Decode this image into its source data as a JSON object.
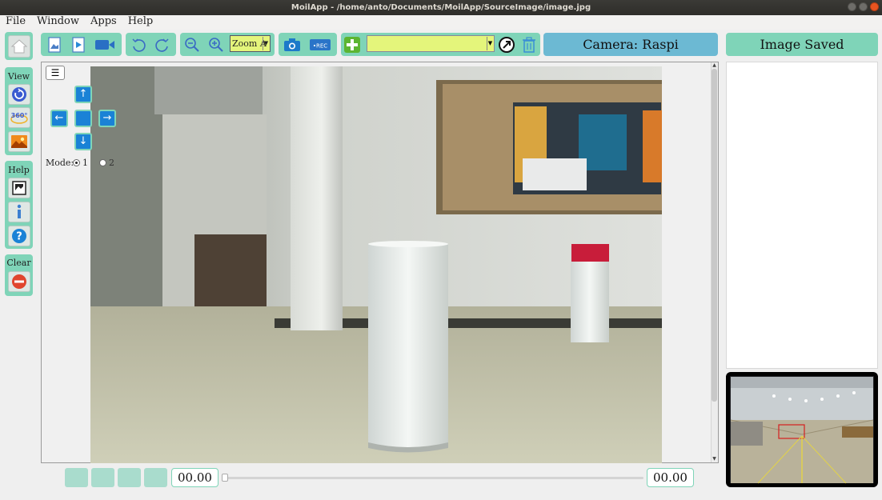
{
  "window": {
    "title": "MoilApp - /home/anto/Documents/MoilApp/SourceImage/image.jpg"
  },
  "menu": [
    "File",
    "Window",
    "Apps",
    "Help"
  ],
  "sidebar": {
    "view_label": "View",
    "help_label": "Help",
    "clear_label": "Clear",
    "view_buttons": [
      "refresh-icon",
      "panorama-360-icon",
      "landscape-image-icon"
    ],
    "help_buttons": [
      "gallery-icon",
      "info-icon",
      "question-icon"
    ],
    "clear_buttons": [
      "remove-icon"
    ]
  },
  "toolbar": {
    "zoom_value": "Zoom A",
    "camera_label": "Camera: Raspi",
    "saved_label": "Image Saved",
    "combo_value": "",
    "rec_text": "•REC"
  },
  "viewer": {
    "mode_label": "Mode:",
    "mode_options": [
      "1",
      "2"
    ],
    "mode_selected": "1"
  },
  "player": {
    "current_time": "00.00",
    "total_time": "00.00",
    "progress": 0
  },
  "colors": {
    "accent": "#7fd4b8",
    "camera_bg": "#6cb9d3",
    "nav_blue": "#1a82d6",
    "combo_bg": "#e4f57b"
  }
}
